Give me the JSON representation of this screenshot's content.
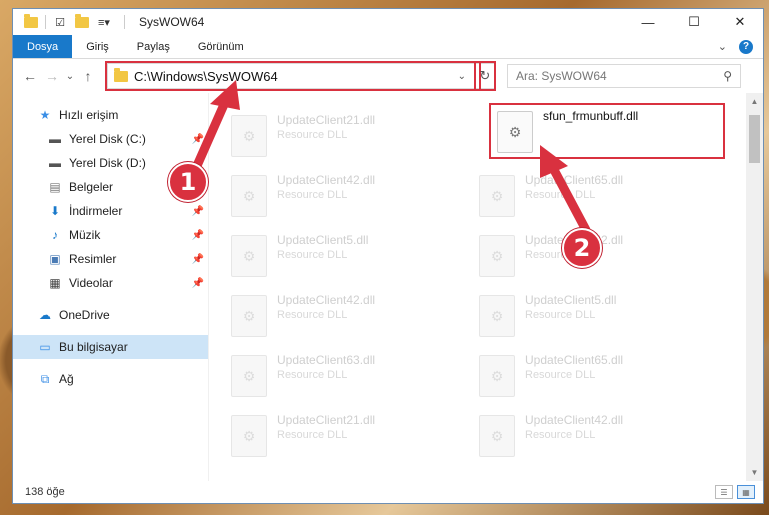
{
  "window": {
    "title": "SysWOW64",
    "controls": {
      "minimize": "—",
      "maximize": "☐",
      "close": "✕"
    }
  },
  "ribbon": {
    "tabs": [
      "Dosya",
      "Giriş",
      "Paylaş",
      "Görünüm"
    ],
    "expand": "⌄",
    "help": "?"
  },
  "navbar": {
    "back": "←",
    "forward": "→",
    "recent": "⌄",
    "up": "↑",
    "address": "C:\\Windows\\SysWOW64",
    "dropdown": "⌄",
    "refresh": "↻",
    "search_placeholder": "Ara: SysWOW64",
    "search_icon": "⚲"
  },
  "sidebar": {
    "items": [
      {
        "label": "Hızlı erişim",
        "icon": "star-icon",
        "pinned": false
      },
      {
        "label": "Yerel Disk (C:)",
        "icon": "drive-icon",
        "pinned": true
      },
      {
        "label": "Yerel Disk (D:)",
        "icon": "drive-icon",
        "pinned": true
      },
      {
        "label": "Belgeler",
        "icon": "documents-icon",
        "pinned": true
      },
      {
        "label": "İndirmeler",
        "icon": "download-icon",
        "pinned": true
      },
      {
        "label": "Müzik",
        "icon": "music-icon",
        "pinned": true
      },
      {
        "label": "Resimler",
        "icon": "pictures-icon",
        "pinned": true
      },
      {
        "label": "Videolar",
        "icon": "videos-icon",
        "pinned": true
      },
      {
        "label": "OneDrive",
        "icon": "cloud-icon"
      },
      {
        "label": "Bu bilgisayar",
        "icon": "computer-icon",
        "selected": true
      },
      {
        "label": "Ağ",
        "icon": "network-icon"
      }
    ]
  },
  "files": [
    {
      "name": "UpdateClient21.dll",
      "type": "Resource DLL"
    },
    {
      "name": "sfun_frmunbuff.dll",
      "type": ""
    },
    {
      "name": "UpdateClient42.dll",
      "type": "Resource DLL"
    },
    {
      "name": "UpdateClient65.dll",
      "type": "Resource DLL"
    },
    {
      "name": "UpdateClient5.dll",
      "type": "Resource DLL"
    },
    {
      "name": "UpdateClient42.dll",
      "type": "Resource DLL"
    },
    {
      "name": "UpdateClient42.dll",
      "type": "Resource DLL"
    },
    {
      "name": "UpdateClient5.dll",
      "type": "Resource DLL"
    },
    {
      "name": "UpdateClient63.dll",
      "type": "Resource DLL"
    },
    {
      "name": "UpdateClient65.dll",
      "type": "Resource DLL"
    },
    {
      "name": "UpdateClient21.dll",
      "type": "Resource DLL"
    },
    {
      "name": "UpdateClient42.dll",
      "type": "Resource DLL"
    }
  ],
  "status": {
    "count": "138 öğe"
  },
  "callouts": {
    "one": "1",
    "two": "2"
  },
  "colors": {
    "accent": "#1979ca",
    "highlight": "#d9313f",
    "selected": "#cde4f7"
  }
}
